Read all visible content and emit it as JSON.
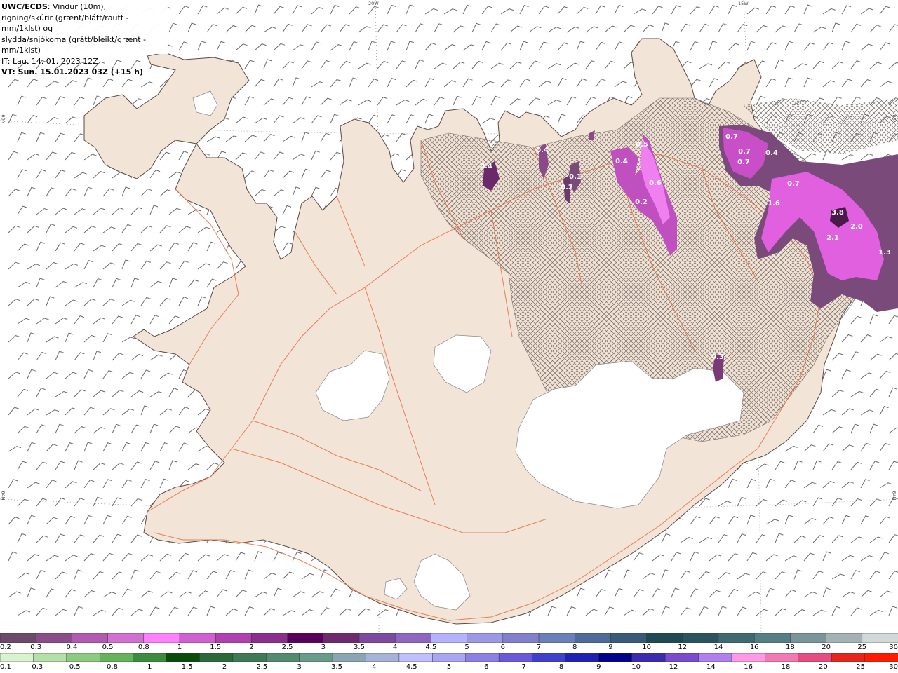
{
  "header": {
    "source": "UWC/ECDS",
    "line1_rest": ": Vindur (10m),",
    "line2": "rigning/skúrir (grænt/blátt/rautt - mm/1klst) og",
    "line3": "slydda/snjókoma (grátt/bleikt/grænt - mm/1klst)",
    "it": "IT: Lau. 14. 01. 2023 12Z",
    "vt": "VT: Sun. 15.01.2023 03Z (+15 h)"
  },
  "graticule_labels": {
    "top_20w": "20W",
    "top_15w": "15W",
    "left_66n": "66N",
    "right_66n": "66N",
    "left_64n": "64N",
    "right_64n": "64N"
  },
  "colors": {
    "land": "#f2e4d6",
    "roads": "#e8734a",
    "glacier": "#ffffff",
    "hatch": "#8a7f7a",
    "sea_barbs": "#666666"
  },
  "precip_labels": [
    {
      "text": "0.4"
    },
    {
      "text": "0.4"
    },
    {
      "text": "0.1"
    },
    {
      "text": "0.2"
    },
    {
      "text": "0.4"
    },
    {
      "text": "0.5"
    },
    {
      "text": "0.6"
    },
    {
      "text": "0.2"
    },
    {
      "text": "0.7"
    },
    {
      "text": "0.7"
    },
    {
      "text": "0.7"
    },
    {
      "text": "0.4"
    },
    {
      "text": "0.7"
    },
    {
      "text": "1.6"
    },
    {
      "text": "3.8"
    },
    {
      "text": "2.0"
    },
    {
      "text": "2.1"
    },
    {
      "text": "1.3"
    },
    {
      "text": "0.3"
    }
  ],
  "legend_snow": {
    "colors": [
      "#6b4a6b",
      "#8a4d8a",
      "#b05ab0",
      "#d070d0",
      "#ff80ff",
      "#d060d0",
      "#b040b0",
      "#8c2e8c",
      "#5a005a",
      "#6e2a6e",
      "#7d4a9e",
      "#8f66bf",
      "#b3b3ff",
      "#9999e6",
      "#8080cc",
      "#6a80b8",
      "#4d6a99",
      "#3a5a7a",
      "#1f4a55",
      "#2a5560",
      "#3f6a70",
      "#557f85",
      "#7a9599",
      "#a3b3b5",
      "#d0d8d8"
    ],
    "ticks": [
      "0.2",
      "0.3",
      "0.4",
      "0.5",
      "0.8",
      "1",
      "1.5",
      "2",
      "2.5",
      "3",
      "3.5",
      "4",
      "4.5",
      "5",
      "6",
      "7",
      "8",
      "9",
      "10",
      "12",
      "14",
      "16",
      "18",
      "20",
      "25",
      "30"
    ]
  },
  "legend_rain": {
    "colors": [
      "#d9f2d0",
      "#b3e0a6",
      "#8ccc80",
      "#66b35c",
      "#3d8c3d",
      "#0a4d0a",
      "#2a6a3a",
      "#3d7a55",
      "#548a70",
      "#6a9a8a",
      "#8aa6b3",
      "#a6b3d9",
      "#bfc0ff",
      "#a6a6f2",
      "#8c80e6",
      "#6a5ad9",
      "#4040cc",
      "#2020b3",
      "#00008c",
      "#3a2ab0",
      "#7a4ad0",
      "#b080f0",
      "#ff99e6",
      "#f27ab3",
      "#e64d80",
      "#e6261a",
      "#ff1a00"
    ],
    "ticks": [
      "0.1",
      "0.3",
      "0.5",
      "0.8",
      "1",
      "1.5",
      "2",
      "2.5",
      "3",
      "3.5",
      "4",
      "4.5",
      "5",
      "6",
      "7",
      "8",
      "9",
      "10",
      "12",
      "14",
      "16",
      "18",
      "20",
      "25",
      "30"
    ]
  }
}
